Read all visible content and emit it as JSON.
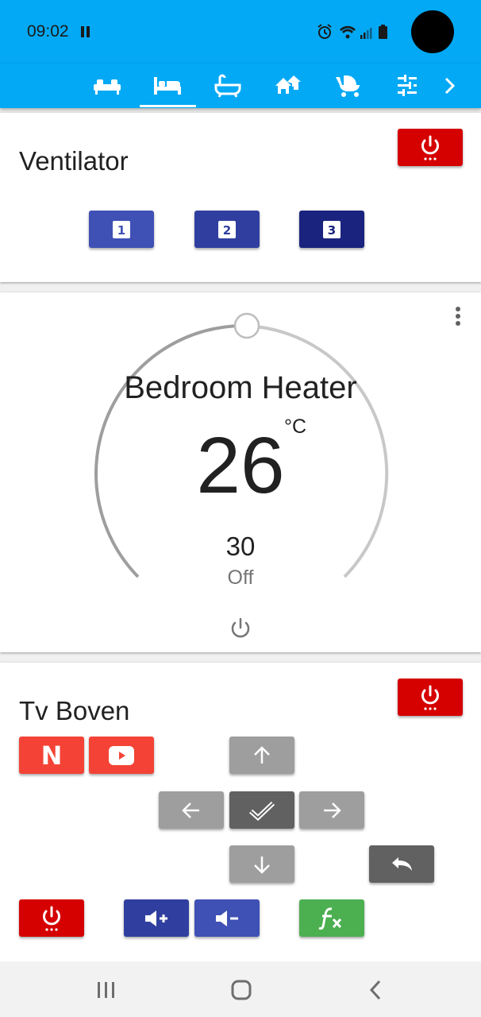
{
  "status_bar": {
    "time": "09:02"
  },
  "tabs": [
    {
      "icon": "sofa-icon"
    },
    {
      "icon": "bed-icon",
      "active": true
    },
    {
      "icon": "bathtub-icon"
    },
    {
      "icon": "home-group-icon"
    },
    {
      "icon": "baby-carriage-icon"
    },
    {
      "icon": "tune-icon"
    },
    {
      "icon": "chevron-right-icon"
    }
  ],
  "ventilator": {
    "title": "Ventilator",
    "speeds": [
      "1",
      "2",
      "3"
    ]
  },
  "heater": {
    "title": "Bedroom Heater",
    "current_temp": "26",
    "unit": "°C",
    "target_temp": "30",
    "mode": "Off",
    "slider_level": 0.5
  },
  "tv": {
    "title": "Tv Boven",
    "netflix_label": "N"
  },
  "colors": {
    "accent": "#03a9f4",
    "power_red": "#d50000",
    "app_red": "#f44336",
    "indigo": "#3f51b5",
    "grey_button": "#9e9e9e",
    "dark_grey_button": "#616161",
    "green": "#4caf50"
  }
}
